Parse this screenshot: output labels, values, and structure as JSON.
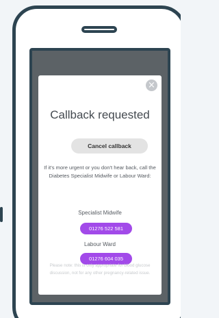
{
  "colors": {
    "frame": "#2d4451",
    "overlay": "#5c6266",
    "accent": "#a24ae9",
    "cancel_bg": "#e3e3e3"
  },
  "modal": {
    "close_icon": "×",
    "title": "Callback requested",
    "cancel_label": "Cancel callback",
    "info_line1": "If it's more urgent or you don't hear back, call the",
    "info_line2": "Diabetes Specialist Midwife or Labour Ward:",
    "contacts": [
      {
        "label": "Specialist Midwife",
        "number": "01276 522 581"
      },
      {
        "label": "Labour Ward",
        "number": "01276 604 035"
      }
    ],
    "note_line1": "Please note: this is only appropriate for blood glucose",
    "note_line2": "discussion, not for any other pregnancy-related issue."
  }
}
